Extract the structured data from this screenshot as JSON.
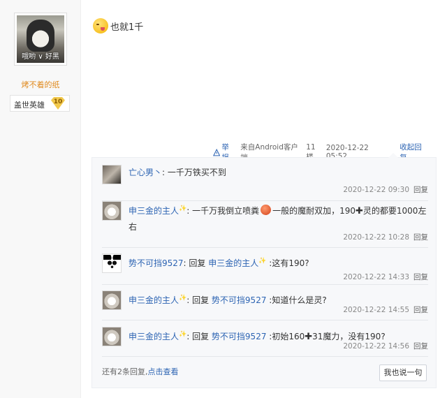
{
  "user": {
    "avatar_caption": "哦哟 ∨ 好黑",
    "name": "烤不着的纸",
    "rank_title": "盖世英雄",
    "rank_level": "10"
  },
  "post": {
    "emoji": "grin-tongue-emoji",
    "text": "也就1千",
    "tail": {
      "report": "举报",
      "source": "来自Android客户端",
      "floor": "11楼",
      "time": "2020-12-22 05:52",
      "collapse": "收起回复"
    }
  },
  "replies": [
    {
      "avatar": "dog-avatar",
      "user": "亡心男丶",
      "text": ": 一千万铁买不到",
      "time": "2020-12-22 09:30",
      "reply_label": "回复"
    },
    {
      "avatar": "cat-avatar",
      "user": "申三金的主人",
      "text_a": ": 一千万我倒立喷粪",
      "text_b": "一般的魔耐双加，190",
      "text_c": "灵的都要1000左右",
      "time": "2020-12-22 10:28",
      "reply_label": "回复"
    },
    {
      "avatar": "panda-avatar",
      "user": "势不可挡9527",
      "reply_word": ": 回复",
      "target": "申三金的主人",
      "text": " :这有190?",
      "time": "2020-12-22 14:33",
      "reply_label": "回复"
    },
    {
      "avatar": "cat-avatar",
      "user": "申三金的主人",
      "reply_word": ": 回复",
      "target": "势不可挡9527",
      "text": " :知道什么是灵?",
      "time": "2020-12-22 14:55",
      "reply_label": "回复"
    },
    {
      "avatar": "cat-avatar",
      "user": "申三金的主人",
      "reply_word": ": 回复",
      "target": "势不可挡9527",
      "text_a": " :初始160",
      "text_b": "31魔力，没有190?",
      "time": "2020-12-22 14:56",
      "reply_label": "回复"
    }
  ],
  "footer": {
    "more_text": "还有2条回复,",
    "more_link": "点击查看",
    "say_button": "我也说一句"
  },
  "colors": {
    "link": "#2d64b3",
    "username_orange": "#e08a1e",
    "badge_gold": "#f2c94c"
  }
}
